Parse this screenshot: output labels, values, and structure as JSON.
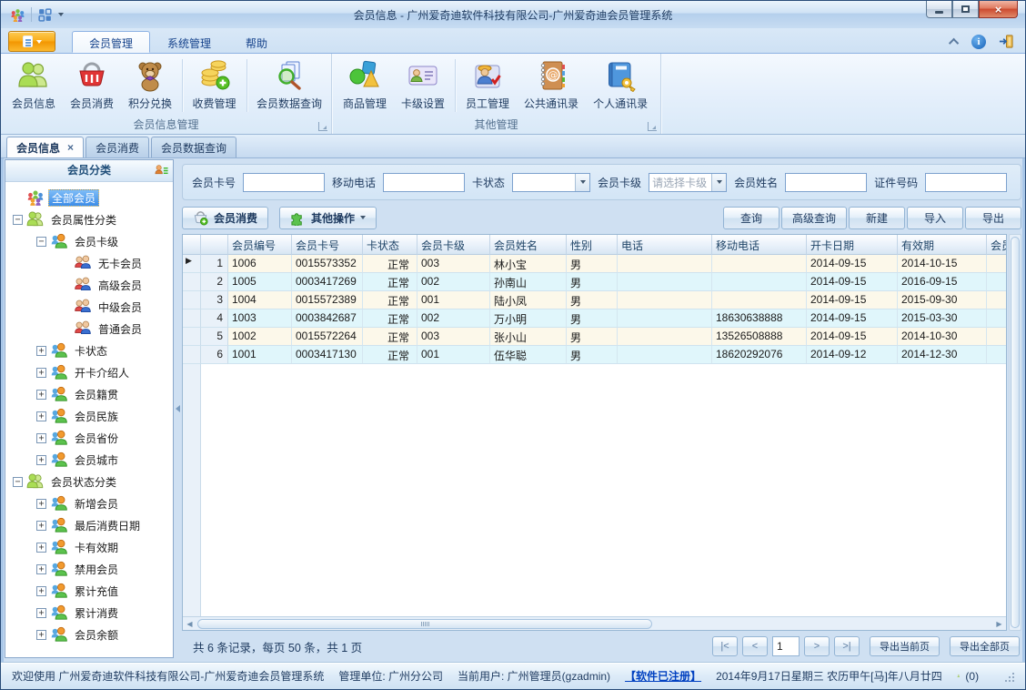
{
  "window": {
    "title": "会员信息 - 广州爱奇迪软件科技有限公司-广州爱奇迪会员管理系统",
    "app_icon": "crowd-icon",
    "quick_access_icon": "grid-icon"
  },
  "menu_tabs": [
    {
      "label": "会员管理",
      "active": true
    },
    {
      "label": "系统管理",
      "active": false
    },
    {
      "label": "帮助",
      "active": false
    }
  ],
  "ribbon": {
    "groups": [
      {
        "label": "会员信息管理",
        "buttons": [
          {
            "label": "会员信息",
            "icon": "members-icon"
          },
          {
            "label": "会员消费",
            "icon": "basket-icon"
          },
          {
            "label": "积分兑换",
            "icon": "teddy-icon",
            "sep_after": true
          },
          {
            "label": "收费管理",
            "icon": "coins-icon",
            "sep_after": true
          },
          {
            "label": "会员数据查询",
            "icon": "doc-search-icon"
          }
        ]
      },
      {
        "label": "其他管理",
        "buttons": [
          {
            "label": "商品管理",
            "icon": "shapes-icon"
          },
          {
            "label": "卡级设置",
            "icon": "card-icon",
            "sep_after": true
          },
          {
            "label": "员工管理",
            "icon": "staff-icon"
          },
          {
            "label": "公共通讯录",
            "icon": "address-book-icon"
          },
          {
            "label": "个人通讯录",
            "icon": "personal-book-icon"
          }
        ]
      }
    ],
    "right_icons": [
      "collapse-chevron-icon",
      "info-icon",
      "exit-icon"
    ]
  },
  "doc_tabs": [
    {
      "label": "会员信息",
      "active": true,
      "closable": true
    },
    {
      "label": "会员消费",
      "active": false
    },
    {
      "label": "会员数据查询",
      "active": false
    }
  ],
  "sidebar": {
    "header": "会员分类",
    "header_icon": "member-list-icon",
    "tree": [
      {
        "label": "全部会员",
        "level": 0,
        "icon": "crowd-icon",
        "exp": "none",
        "sel": true
      },
      {
        "label": "会员属性分类",
        "level": 0,
        "icon": "group-icon",
        "exp": "minus"
      },
      {
        "label": "会员卡级",
        "level": 1,
        "icon": "duo-icon",
        "exp": "minus"
      },
      {
        "label": "无卡会员",
        "level": 2,
        "icon": "pair-icon",
        "exp": "none"
      },
      {
        "label": "高级会员",
        "level": 2,
        "icon": "pair-icon",
        "exp": "none"
      },
      {
        "label": "中级会员",
        "level": 2,
        "icon": "pair-icon",
        "exp": "none"
      },
      {
        "label": "普通会员",
        "level": 2,
        "icon": "pair-icon",
        "exp": "none"
      },
      {
        "label": "卡状态",
        "level": 1,
        "icon": "duo-icon",
        "exp": "plus"
      },
      {
        "label": "开卡介绍人",
        "level": 1,
        "icon": "duo-icon",
        "exp": "plus"
      },
      {
        "label": "会员籍贯",
        "level": 1,
        "icon": "duo-icon",
        "exp": "plus"
      },
      {
        "label": "会员民族",
        "level": 1,
        "icon": "duo-icon",
        "exp": "plus"
      },
      {
        "label": "会员省份",
        "level": 1,
        "icon": "duo-icon",
        "exp": "plus"
      },
      {
        "label": "会员城市",
        "level": 1,
        "icon": "duo-icon",
        "exp": "plus"
      },
      {
        "label": "会员状态分类",
        "level": 0,
        "icon": "group-icon",
        "exp": "minus"
      },
      {
        "label": "新增会员",
        "level": 1,
        "icon": "duo-icon",
        "exp": "plus"
      },
      {
        "label": "最后消费日期",
        "level": 1,
        "icon": "duo-icon",
        "exp": "plus"
      },
      {
        "label": "卡有效期",
        "level": 1,
        "icon": "duo-icon",
        "exp": "plus"
      },
      {
        "label": "禁用会员",
        "level": 1,
        "icon": "duo-icon",
        "exp": "plus"
      },
      {
        "label": "累计充值",
        "level": 1,
        "icon": "duo-icon",
        "exp": "plus"
      },
      {
        "label": "累计消费",
        "level": 1,
        "icon": "duo-icon",
        "exp": "plus"
      },
      {
        "label": "会员余额",
        "level": 1,
        "icon": "duo-icon",
        "exp": "plus"
      }
    ]
  },
  "filters": [
    {
      "label": "会员卡号",
      "control": "input",
      "value": ""
    },
    {
      "label": "移动电话",
      "control": "input",
      "value": ""
    },
    {
      "label": "卡状态",
      "control": "combo",
      "value": ""
    },
    {
      "label": "会员卡级",
      "control": "combo",
      "value": "请选择卡级",
      "placeholder": true
    },
    {
      "label": "会员姓名",
      "control": "input",
      "value": ""
    },
    {
      "label": "证件号码",
      "control": "input",
      "value": ""
    }
  ],
  "actions": {
    "left": [
      {
        "label": "会员消费",
        "icon": "basket-plus-icon"
      },
      {
        "label": "其他操作",
        "icon": "puzzle-icon",
        "dropdown": true
      }
    ],
    "right": [
      "查询",
      "高级查询",
      "新建",
      "导入",
      "导出"
    ]
  },
  "table": {
    "columns": [
      "会员编号",
      "会员卡号",
      "卡状态",
      "会员卡级",
      "会员姓名",
      "性别",
      "电话",
      "移动电话",
      "开卡日期",
      "有效期",
      "会员"
    ],
    "rows": [
      [
        "1006",
        "0015573352",
        "正常",
        "003",
        "林小宝",
        "男",
        "",
        "",
        "2014-09-15",
        "2014-10-15",
        ""
      ],
      [
        "1005",
        "0003417269",
        "正常",
        "002",
        "孙南山",
        "男",
        "",
        "",
        "2014-09-15",
        "2016-09-15",
        ""
      ],
      [
        "1004",
        "0015572389",
        "正常",
        "001",
        "陆小凤",
        "男",
        "",
        "",
        "2014-09-15",
        "2015-09-30",
        ""
      ],
      [
        "1003",
        "0003842687",
        "正常",
        "002",
        "万小明",
        "男",
        "",
        "18630638888",
        "2014-09-15",
        "2015-03-30",
        ""
      ],
      [
        "1002",
        "0015572264",
        "正常",
        "003",
        "张小山",
        "男",
        "",
        "13526508888",
        "2014-09-15",
        "2014-10-30",
        ""
      ],
      [
        "1001",
        "0003417130",
        "正常",
        "001",
        "伍华聪",
        "男",
        "",
        "18620292076",
        "2014-09-12",
        "2014-12-30",
        ""
      ]
    ],
    "active_row": 0
  },
  "pager": {
    "summary": "共 6 条记录，每页 50 条，共 1 页",
    "first": "|<",
    "prev": "<",
    "page": "1",
    "next": ">",
    "last": ">|",
    "export_current": "导出当前页",
    "export_all": "导出全部页"
  },
  "statusbar": {
    "welcome": "欢迎使用 广州爱奇迪软件科技有限公司-广州爱奇迪会员管理系统",
    "unit": "管理单位: 广州分公司",
    "user": "当前用户: 广州管理员(gzadmin)",
    "registered": "【软件已注册】",
    "datetime": "2014年9月17日星期三 农历甲午[马]年八月廿四",
    "message_icon": "person-icon",
    "message_count": "(0)"
  },
  "colors": {
    "accent_orange": "#f9ab17",
    "selection_blue": "#3d8de8",
    "row_cream": "#fcf8ea",
    "row_cyan": "#e0f6fb",
    "status_ok": "正常"
  }
}
